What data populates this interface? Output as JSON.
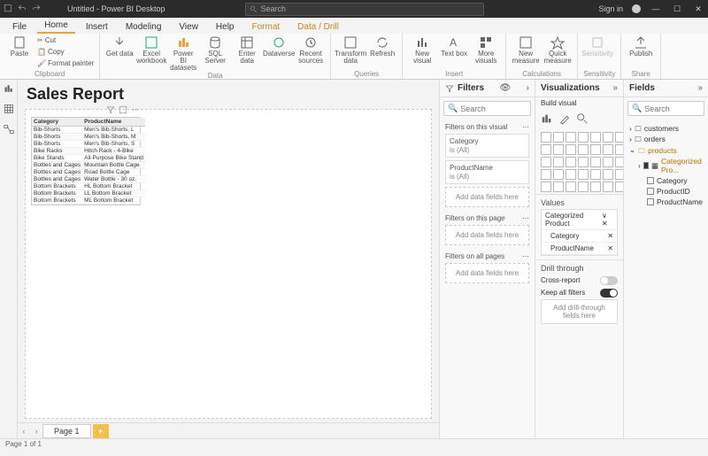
{
  "titlebar": {
    "filename": "Untitled - Power BI Desktop",
    "search_placeholder": "Search",
    "signin": "Sign in"
  },
  "tabs": {
    "file": "File",
    "home": "Home",
    "insert": "Insert",
    "modeling": "Modeling",
    "view": "View",
    "help": "Help",
    "format": "Format",
    "datadrill": "Data / Drill"
  },
  "ribbon": {
    "clipboard": {
      "paste": "Paste",
      "cut": "Cut",
      "copy": "Copy",
      "fmtpainter": "Format painter",
      "label": "Clipboard"
    },
    "data": {
      "getdata": "Get data",
      "excel": "Excel workbook",
      "pbi": "Power BI datasets",
      "sql": "SQL Server",
      "enter": "Enter data",
      "dataverse": "Dataverse",
      "recent": "Recent sources",
      "label": "Data"
    },
    "queries": {
      "transform": "Transform data",
      "refresh": "Refresh",
      "label": "Queries"
    },
    "insert": {
      "newvisual": "New visual",
      "textbox": "Text box",
      "more": "More visuals",
      "label": "Insert"
    },
    "calc": {
      "newmeasure": "New measure",
      "quick": "Quick measure",
      "label": "Calculations"
    },
    "sens": {
      "sens": "Sensitivity",
      "label": "Sensitivity"
    },
    "share": {
      "publish": "Publish",
      "label": "Share"
    }
  },
  "report": {
    "title": "Sales Report"
  },
  "table": {
    "headers": [
      "Category",
      "ProductName"
    ],
    "rows": [
      [
        "Bib-Shorts",
        "Men's Bib-Shorts, L"
      ],
      [
        "Bib-Shorts",
        "Men's Bib-Shorts, M"
      ],
      [
        "Bib-Shorts",
        "Men's Bib-Shorts, S"
      ],
      [
        "Bike Racks",
        "Hitch Rack - 4-Bike"
      ],
      [
        "Bike Stands",
        "All-Purpose Bike Stand"
      ],
      [
        "Bottles and Cages",
        "Mountain Bottle Cage"
      ],
      [
        "Bottles and Cages",
        "Road Bottle Cage"
      ],
      [
        "Bottles and Cages",
        "Water Bottle - 30 oz."
      ],
      [
        "Bottom Brackets",
        "HL Bottom Bracket"
      ],
      [
        "Bottom Brackets",
        "LL Bottom Bracket"
      ],
      [
        "Bottom Brackets",
        "ML Bottom Bracket"
      ]
    ]
  },
  "filters": {
    "title": "Filters",
    "search": "Search",
    "onvisual": "Filters on this visual",
    "category": "Category",
    "isall": "is (All)",
    "productname": "ProductName",
    "adddata": "Add data fields here",
    "onpage": "Filters on this page",
    "onall": "Filters on all pages"
  },
  "viz": {
    "title": "Visualizations",
    "build": "Build visual",
    "values": "Values",
    "catprod": "Categorized Product",
    "category": "Category",
    "productname": "ProductName",
    "drill": "Drill through",
    "cross": "Cross-report",
    "keep": "Keep all filters",
    "adddrill": "Add drill-through fields here"
  },
  "fields": {
    "title": "Fields",
    "search": "Search",
    "customers": "customers",
    "orders": "orders",
    "products": "products",
    "catpro": "Categorized Pro...",
    "category": "Category",
    "productid": "ProductID",
    "productname": "ProductName"
  },
  "pages": {
    "page1": "Page 1",
    "status": "Page 1 of 1"
  }
}
